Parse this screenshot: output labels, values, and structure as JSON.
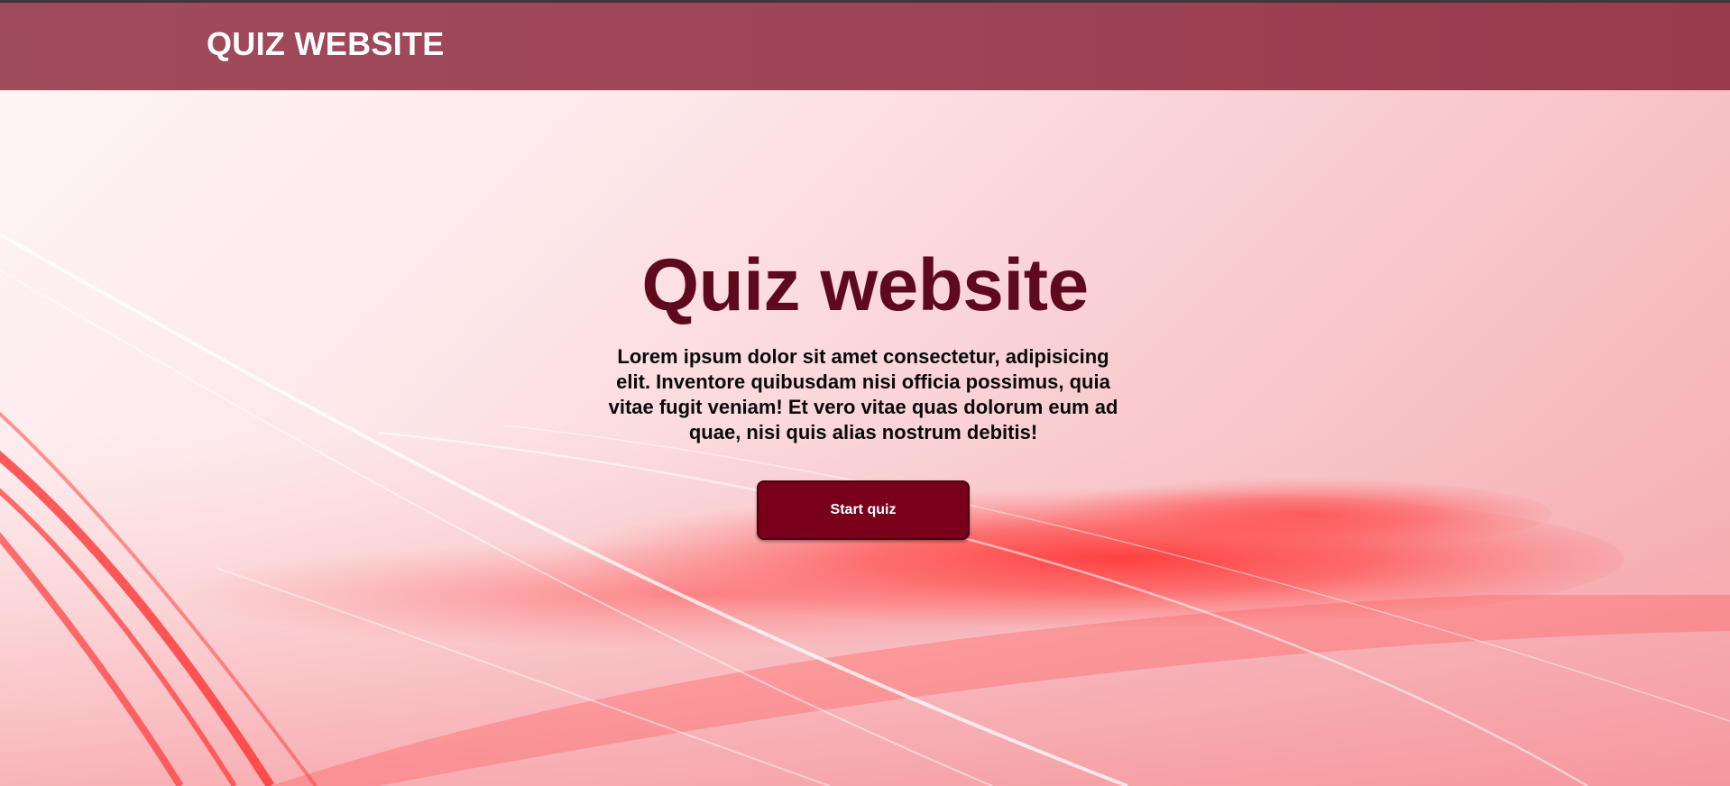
{
  "header": {
    "brand": "QUIZ WEBSITE"
  },
  "hero": {
    "title": "Quiz website",
    "description": "Lorem ipsum dolor sit amet consectetur, adipisicing elit. Inventore quibusdam nisi officia possimus, quia vitae fugit veniam! Et vero vitae quas dolorum eum ad quae, nisi quis alias nostrum debitis!",
    "start_label": "Start quiz"
  },
  "colors": {
    "header_bg": "#9d4456",
    "title_color": "#5e0a1c",
    "button_bg": "#78001a",
    "background_accent": "#ff3b3b"
  }
}
